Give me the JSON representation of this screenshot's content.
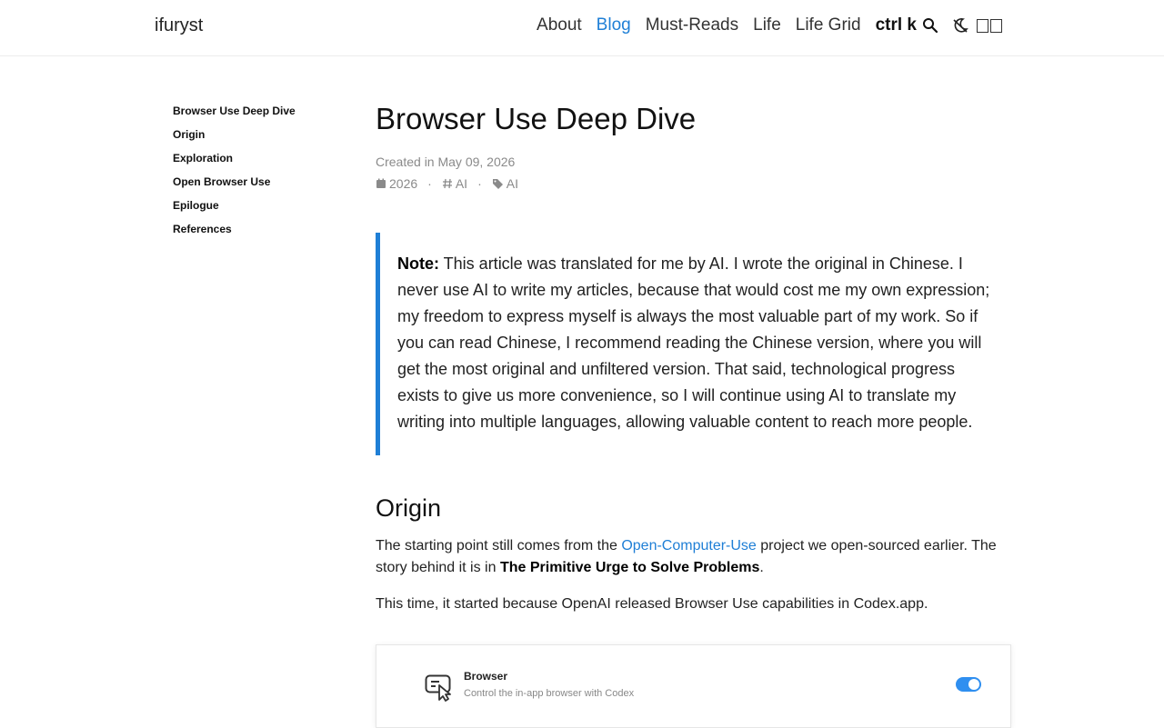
{
  "header": {
    "brand": "ifuryst",
    "nav": [
      "About",
      "Blog",
      "Must-Reads",
      "Life",
      "Life Grid"
    ],
    "active": "Blog",
    "shortcut": "ctrl k",
    "accent": "#1f7fd6"
  },
  "toc": {
    "items": [
      "Browser Use Deep Dive",
      "Origin",
      "Exploration",
      "Open Browser Use",
      "Epilogue",
      "References"
    ]
  },
  "article": {
    "title": "Browser Use Deep Dive",
    "created": "Created in May 09, 2026",
    "year": "2026",
    "category": "AI",
    "tag": "AI",
    "note_label": "Note:",
    "note_text": " This article was translated for me by AI. I wrote the original in Chinese. I never use AI to write my articles, because that would cost me my own expression; my freedom to express myself is always the most valuable part of my work. So if you can read Chinese, I recommend reading the Chinese version, where you will get the most original and unfiltered version. That said, technological progress exists to give us more convenience, so I will continue using AI to translate my writing into multiple languages, allowing valuable content to reach more people.",
    "section_title": "Origin",
    "p1_before": "The starting point still comes from the ",
    "p1_link": "Open-Computer-Use",
    "p1_middle": " project we open-sourced earlier. The story behind it is in ",
    "p1_bold": "The Primitive Urge to Solve Problems",
    "p1_end": ".",
    "p2": "This time, it started because OpenAI released Browser Use capabilities in Codex.app.",
    "card": {
      "title": "Browser",
      "subtitle": "Control the in-app browser with Codex",
      "toggle_on": true,
      "toggle_color": "#2f8ff0"
    }
  }
}
